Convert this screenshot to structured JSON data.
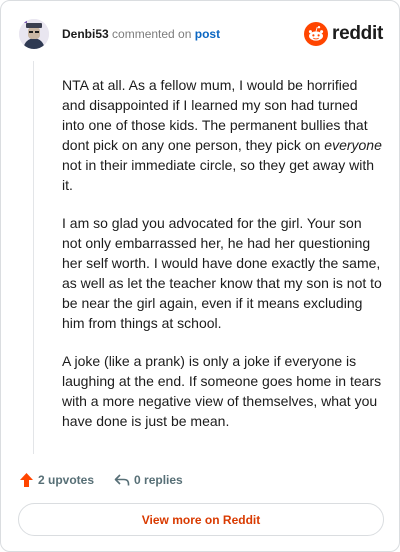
{
  "header": {
    "username": "Denbi53",
    "action_text": "commented on",
    "post_link": "post",
    "brand": "reddit"
  },
  "comment": {
    "p1_before": "NTA at all. As a fellow mum, I would be horrified and disappointed if I learned my son had turned into one of those kids. The permanent bullies that dont pick on any one person, they pick on ",
    "p1_emphasis": "everyone",
    "p1_after": " not in their immediate circle, so they get away with it.",
    "p2": "I am so glad you advocated for the girl. Your son not only embarrassed her, he had her questioning her self worth. I would have done exactly the same, as well as let the teacher know that my son is not to be near the girl again, even if it means excluding him from things at school.",
    "p3": "A joke (like a prank) is only a joke if everyone is laughing at the end. If someone goes home in tears with a more negative view of themselves, what you have done is just be mean."
  },
  "footer": {
    "upvotes": "2 upvotes",
    "replies": "0 replies",
    "upvote_icon": "upvote-arrow-icon",
    "reply_icon": "reply-arrow-icon"
  },
  "actions": {
    "view_more": "View more on Reddit"
  },
  "colors": {
    "accent": "#ff4500",
    "link": "#0a66c2",
    "view_more_text": "#d93a00"
  }
}
